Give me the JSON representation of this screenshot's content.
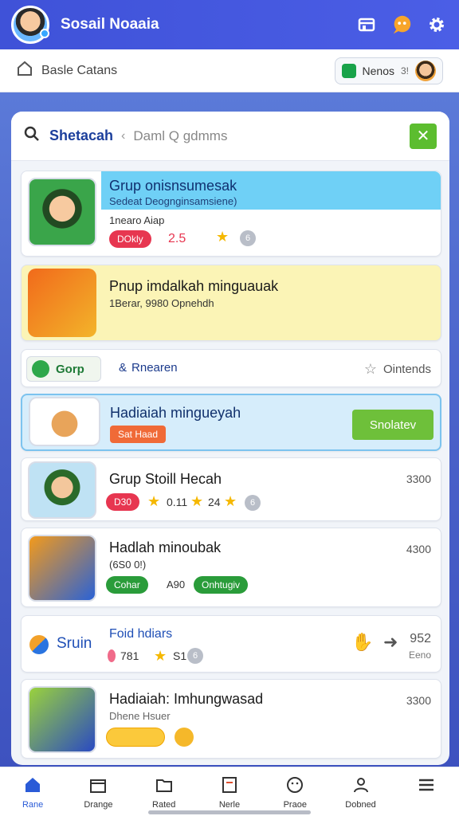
{
  "app": {
    "title": "Sosail Noaaia"
  },
  "subbar": {
    "title": "Basle Catans",
    "chip_label": "Nenos",
    "chip_extra": "3!"
  },
  "search": {
    "query": "Shetacah",
    "placeholder": "Daml Q gdmms"
  },
  "cards": [
    {
      "title": "Grup onisnsumesak",
      "subtitle": "Sedeat Deognginsamsiene)",
      "meta": "1nearo Aiap",
      "badge": "DOkly",
      "rating": "2.5",
      "extra": "6"
    },
    {
      "title": "Pnup imdalkah minguauak",
      "meta": "1Berar, 9980 Opnehdh"
    },
    {
      "tab_left": "Gorp",
      "tab_mid": "Rnearen",
      "tab_right": "Ointends"
    },
    {
      "title": "Hadiaiah mingueyah",
      "badge": "Sat Haad",
      "button": "Snolatev"
    },
    {
      "title": "Grup Stoill Hecah",
      "badge": "D30",
      "r1": "0.11",
      "r2": "24",
      "right": "3300",
      "extra": "6"
    },
    {
      "title": "Hadlah minoubak",
      "subtitle": "(6S0 0!)",
      "badge1": "Cohar",
      "mid": "A90",
      "badge2": "Onhtugiv",
      "right": "4300"
    },
    {
      "title": "Foid hdiars",
      "left_label": "Sruin",
      "meta": "781",
      "r1": "S1",
      "extra": "6",
      "right": "952",
      "right_sub": "Eeno"
    },
    {
      "title": "Hadiaiah: Imhungwasad",
      "subtitle": "Dhene Hsuer",
      "right": "3300"
    }
  ],
  "nav": [
    {
      "label": "Rane",
      "icon": "home-icon"
    },
    {
      "label": "Drange",
      "icon": "box-icon"
    },
    {
      "label": "Rated",
      "icon": "folder-icon"
    },
    {
      "label": "Nerle",
      "icon": "note-icon"
    },
    {
      "label": "Praoe",
      "icon": "face-icon"
    },
    {
      "label": "Dobned",
      "icon": "user-icon"
    },
    {
      "label": "",
      "icon": "menu-icon"
    }
  ]
}
